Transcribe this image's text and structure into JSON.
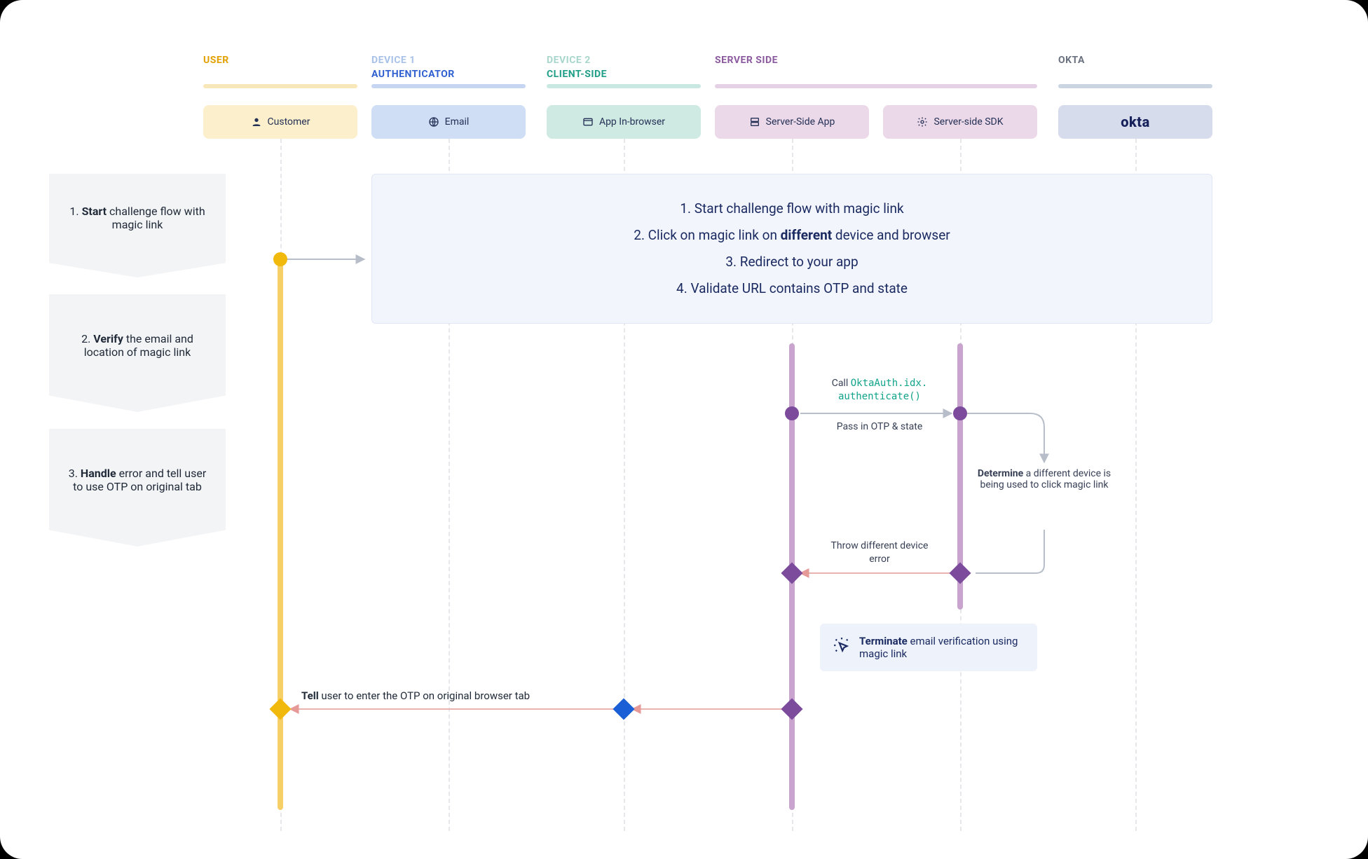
{
  "lanes": {
    "user": {
      "label": "USER",
      "box": "Customer"
    },
    "auth": {
      "top": "DEVICE 1",
      "label": "AUTHENTICATOR",
      "box": "Email"
    },
    "client": {
      "top": "DEVICE 2",
      "label": "CLIENT-SIDE",
      "box": "App In-browser"
    },
    "server": {
      "label": "SERVER SIDE",
      "app_box": "Server-Side App",
      "sdk_box": "Server-side SDK"
    },
    "okta": {
      "label": "OKTA",
      "box": "okta"
    }
  },
  "steps": {
    "s1_pre": "1. ",
    "s1_b": "Start",
    "s1_post": " challenge flow with magic link",
    "s2_pre": "2. ",
    "s2_b": "Verify",
    "s2_post": " the email and location of magic link",
    "s3_pre": "3. ",
    "s3_b": "Handle",
    "s3_post": " error and tell user to use OTP on original tab"
  },
  "summary": {
    "l1_pre": "1.  Start challenge flow with magic link",
    "l2_pre": "2. Click on magic link on ",
    "l2_b": "different",
    "l2_post": " device and browser",
    "l3": "3. Redirect to your app",
    "l4": "4. Validate URL contains OTP and state"
  },
  "msgs": {
    "call_pre": "Call ",
    "call_code1": "OktaAuth.idx.",
    "call_code2": "authenticate()",
    "pass": "Pass in OTP & state",
    "determine_b": "Determine",
    "determine_post": " a different device is being used to click magic link",
    "throw": "Throw different device error"
  },
  "terminate": {
    "b": "Terminate",
    "post": " email verification using magic link"
  },
  "tell": {
    "b": "Tell",
    "post": " user to enter the OTP on original browser tab"
  }
}
